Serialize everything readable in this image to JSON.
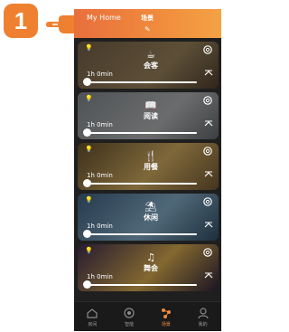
{
  "step": {
    "number": "1",
    "color": "#ee8030"
  },
  "header": {
    "home_title": "My Home",
    "page_title": "场景",
    "gradient": [
      "#e86f3d",
      "#f4a244"
    ]
  },
  "scenes": [
    {
      "name": "会客",
      "icon": "coffee-icon",
      "timer": "1h 0min",
      "bg": [
        "#6e5a44",
        "#8f7a55"
      ]
    },
    {
      "name": "阅读",
      "icon": "book-icon",
      "timer": "1h 0min",
      "bg": [
        "#7a7f84",
        "#a5a7a8"
      ]
    },
    {
      "name": "用餐",
      "icon": "dining-icon",
      "timer": "1h 0min",
      "bg": [
        "#5e4b2b",
        "#c4a05a"
      ]
    },
    {
      "name": "休闲",
      "icon": "umbrella-icon",
      "timer": "1h 0min",
      "bg": [
        "#3d5a78",
        "#7aa0b8"
      ]
    },
    {
      "name": "舞会",
      "icon": "music-icon",
      "timer": "1h 0min",
      "bg": [
        "#3b2a4a",
        "#caa04a"
      ]
    }
  ],
  "tabbar": {
    "items": [
      {
        "label": "房间",
        "icon": "room-icon",
        "active": false
      },
      {
        "label": "智能",
        "icon": "smart-icon",
        "active": false
      },
      {
        "label": "场景",
        "icon": "scene-icon",
        "active": true
      },
      {
        "label": "我的",
        "icon": "profile-icon",
        "active": false
      }
    ],
    "accent": "#f08a3d"
  }
}
